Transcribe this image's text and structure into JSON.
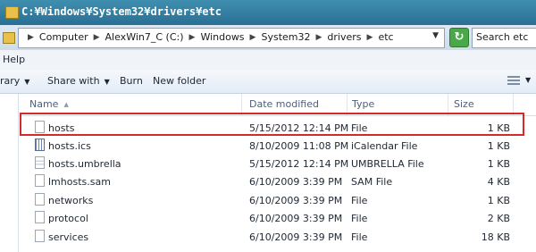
{
  "window": {
    "title": "C:¥Windows¥System32¥drivers¥etc"
  },
  "address": {
    "crumbs": [
      "Computer",
      "AlexWin7_C (C:)",
      "Windows",
      "System32",
      "drivers",
      "etc"
    ]
  },
  "search": {
    "text": "Search etc"
  },
  "menubar": {
    "help": "Help"
  },
  "toolbar": {
    "library": "rary",
    "share_with": "Share with",
    "burn": "Burn",
    "new_folder": "New folder"
  },
  "columns": {
    "name": "Name",
    "date": "Date modified",
    "type": "Type",
    "size": "Size"
  },
  "files": [
    {
      "name": "hosts",
      "date": "5/15/2012 12:14 PM",
      "type": "File",
      "size": "1 KB",
      "icon": "file-icon"
    },
    {
      "name": "hosts.ics",
      "date": "8/10/2009 11:08 PM",
      "type": "iCalendar File",
      "size": "1 KB",
      "icon": "calendar-file-icon"
    },
    {
      "name": "hosts.umbrella",
      "date": "5/15/2012 12:14 PM",
      "type": "UMBRELLA File",
      "size": "1 KB",
      "icon": "umbrella-file-icon"
    },
    {
      "name": "lmhosts.sam",
      "date": "6/10/2009 3:39 PM",
      "type": "SAM File",
      "size": "4 KB",
      "icon": "file-icon"
    },
    {
      "name": "networks",
      "date": "6/10/2009 3:39 PM",
      "type": "File",
      "size": "1 KB",
      "icon": "file-icon"
    },
    {
      "name": "protocol",
      "date": "6/10/2009 3:39 PM",
      "type": "File",
      "size": "2 KB",
      "icon": "file-icon"
    },
    {
      "name": "services",
      "date": "6/10/2009 3:39 PM",
      "type": "File",
      "size": "18 KB",
      "icon": "file-icon"
    }
  ],
  "colors": {
    "highlight": "#d42a2a",
    "titlebar": "#3f8fb0",
    "refresh": "#4aa84a"
  }
}
